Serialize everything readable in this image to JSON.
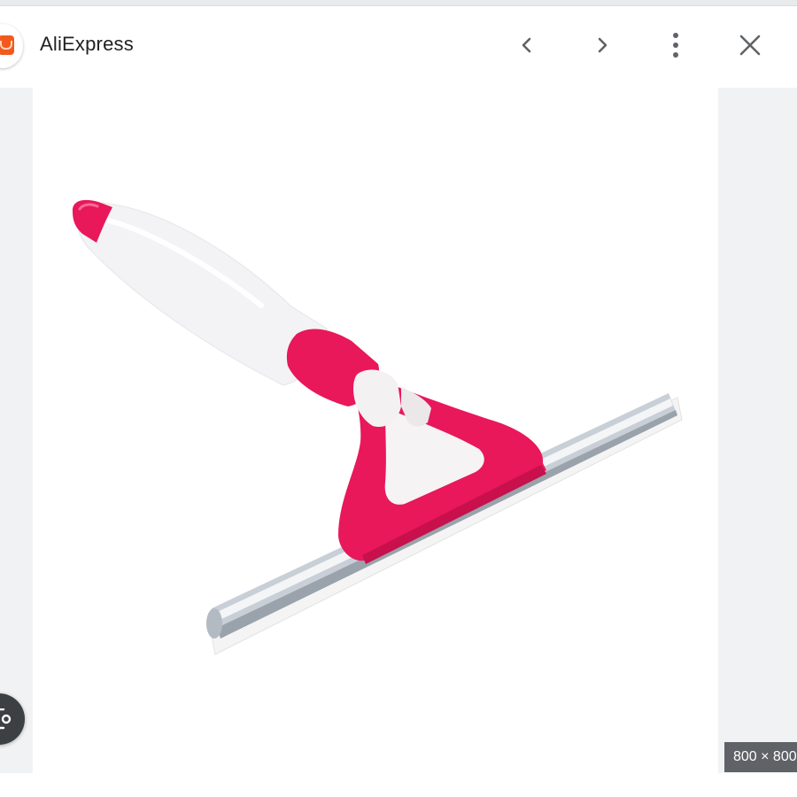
{
  "header": {
    "source_title": "AliExpress",
    "favicon_icon": "aliexpress-logo-icon",
    "prev_icon": "chevron-left-icon",
    "next_icon": "chevron-right-icon",
    "more_icon": "more-vert-icon",
    "close_icon": "close-icon"
  },
  "image": {
    "dimensions_label": "800 × 800"
  },
  "lens": {
    "icon": "lens-search-icon"
  },
  "colors": {
    "accent_pink": "#e8185a",
    "brand_orange": "#f25a1d",
    "panel_gray": "#f1f2f4",
    "badge_gray": "#5f6368"
  }
}
